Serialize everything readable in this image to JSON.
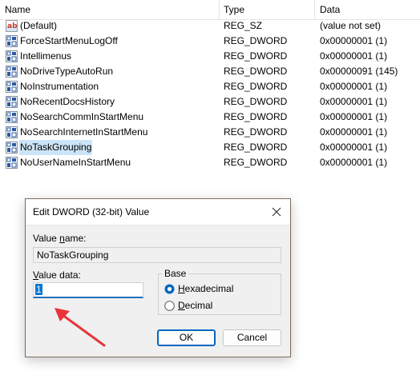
{
  "columns": {
    "name": "Name",
    "type": "Type",
    "data": "Data"
  },
  "rows": [
    {
      "name": "(Default)",
      "type": "REG_SZ",
      "data": "(value not set)",
      "icon": "string-value-icon",
      "selected": false
    },
    {
      "name": "ForceStartMenuLogOff",
      "type": "REG_DWORD",
      "data": "0x00000001 (1)",
      "icon": "dword-value-icon",
      "selected": false
    },
    {
      "name": "Intellimenus",
      "type": "REG_DWORD",
      "data": "0x00000001 (1)",
      "icon": "dword-value-icon",
      "selected": false
    },
    {
      "name": "NoDriveTypeAutoRun",
      "type": "REG_DWORD",
      "data": "0x00000091 (145)",
      "icon": "dword-value-icon",
      "selected": false
    },
    {
      "name": "NoInstrumentation",
      "type": "REG_DWORD",
      "data": "0x00000001 (1)",
      "icon": "dword-value-icon",
      "selected": false
    },
    {
      "name": "NoRecentDocsHistory",
      "type": "REG_DWORD",
      "data": "0x00000001 (1)",
      "icon": "dword-value-icon",
      "selected": false
    },
    {
      "name": "NoSearchCommInStartMenu",
      "type": "REG_DWORD",
      "data": "0x00000001 (1)",
      "icon": "dword-value-icon",
      "selected": false
    },
    {
      "name": "NoSearchInternetInStartMenu",
      "type": "REG_DWORD",
      "data": "0x00000001 (1)",
      "icon": "dword-value-icon",
      "selected": false
    },
    {
      "name": "NoTaskGrouping",
      "type": "REG_DWORD",
      "data": "0x00000001 (1)",
      "icon": "dword-value-icon",
      "selected": true
    },
    {
      "name": "NoUserNameInStartMenu",
      "type": "REG_DWORD",
      "data": "0x00000001 (1)",
      "icon": "dword-value-icon",
      "selected": false
    }
  ],
  "dialog": {
    "title": "Edit DWORD (32-bit) Value",
    "value_name_label_pre": "Value ",
    "value_name_label_key": "n",
    "value_name_label_post": "ame:",
    "value_name": "NoTaskGrouping",
    "value_data_label_pre": "",
    "value_data_label_key": "V",
    "value_data_label_post": "alue data:",
    "value_data": "1",
    "base_label": "Base",
    "hex_key": "H",
    "hex_rest": "exadecimal",
    "dec_key": "D",
    "dec_rest": "ecimal",
    "selected_base": "hexadecimal",
    "ok_label": "OK",
    "cancel_label": "Cancel"
  },
  "colors": {
    "accent": "#0067c0",
    "selection": "#cce4f7",
    "arrow": "#e8343b"
  }
}
